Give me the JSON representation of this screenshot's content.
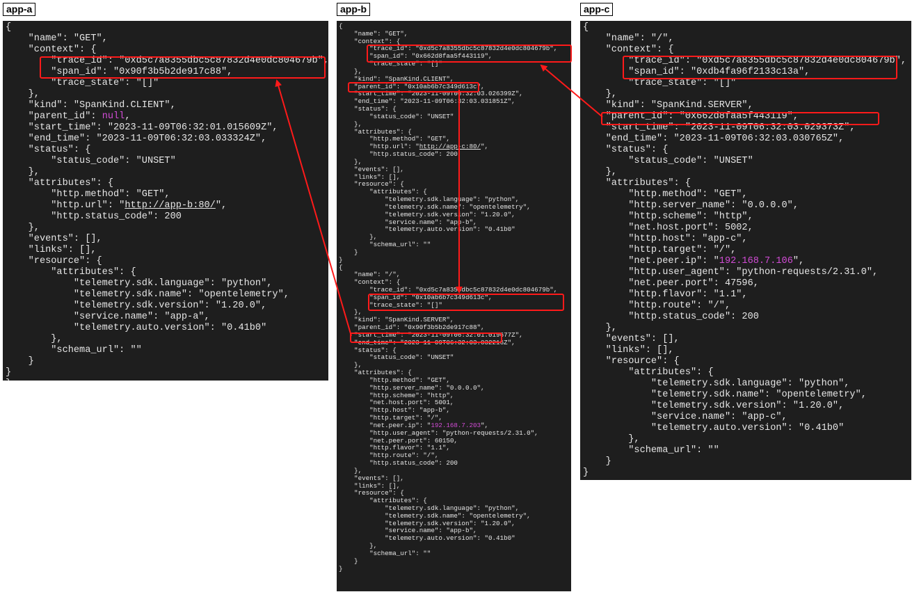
{
  "labels": {
    "a": "app-a",
    "b": "app-b",
    "c": "app-c"
  },
  "colors": {
    "terminal_bg": "#1e1e1e",
    "text": "#e6e6e6",
    "highlight_box": "#ff1a1a",
    "null_and_ip": "#d24cd6"
  },
  "app_a": {
    "top_fragment": "{",
    "lines": [
      "{",
      "    \"name\": \"GET\",",
      "    \"context\": {",
      "        \"trace_id\": \"0xd5c7a8355dbc5c87832d4e0dc804679b\",",
      "        \"span_id\": \"0x90f3b5b2de917c88\",",
      "        \"trace_state\": \"[]\"",
      "    },",
      "    \"kind\": \"SpanKind.CLIENT\",",
      "    \"parent_id\": null,",
      "    \"start_time\": \"2023-11-09T06:32:01.015609Z\",",
      "    \"end_time\": \"2023-11-09T06:32:03.033324Z\",",
      "    \"status\": {",
      "        \"status_code\": \"UNSET\"",
      "    },",
      "    \"attributes\": {",
      "        \"http.method\": \"GET\",",
      "        \"http.url\": \"http://app-b:80/\",",
      "        \"http.status_code\": 200",
      "    },",
      "    \"events\": [],",
      "    \"links\": [],",
      "    \"resource\": {",
      "        \"attributes\": {",
      "            \"telemetry.sdk.language\": \"python\",",
      "            \"telemetry.sdk.name\": \"opentelemetry\",",
      "            \"telemetry.sdk.version\": \"1.20.0\",",
      "            \"service.name\": \"app-a\",",
      "            \"telemetry.auto.version\": \"0.41b0\"",
      "        },",
      "        \"schema_url\": \"\"",
      "    }",
      "}",
      "}"
    ]
  },
  "app_b": {
    "lines": [
      "{",
      "    \"name\": \"GET\",",
      "    \"context\": {",
      "        \"trace_id\": \"0xd5c7a8355dbc5c87832d4e0dc804679b\",",
      "        \"span_id\": \"0x662d8faa5f443119\",",
      "        \"trace_state\": \"[]\"",
      "    },",
      "    \"kind\": \"SpanKind.CLIENT\",",
      "    \"parent_id\": \"0x10ab6b7c349d613c\",",
      "    \"start_time\": \"2023-11-09T06:32:03.026399Z\",",
      "    \"end_time\": \"2023-11-09T06:32:03.031851Z\",",
      "    \"status\": {",
      "        \"status_code\": \"UNSET\"",
      "    },",
      "    \"attributes\": {",
      "        \"http.method\": \"GET\",",
      "        \"http.url\": \"http://app-c:80/\",",
      "        \"http.status_code\": 200",
      "    },",
      "    \"events\": [],",
      "    \"links\": [],",
      "    \"resource\": {",
      "        \"attributes\": {",
      "            \"telemetry.sdk.language\": \"python\",",
      "            \"telemetry.sdk.name\": \"opentelemetry\",",
      "            \"telemetry.sdk.version\": \"1.20.0\",",
      "            \"service.name\": \"app-b\",",
      "            \"telemetry.auto.version\": \"0.41b0\"",
      "        },",
      "        \"schema_url\": \"\"",
      "    }",
      "}",
      "{",
      "    \"name\": \"/\",",
      "    \"context\": {",
      "        \"trace_id\": \"0xd5c7a8355dbc5c87832d4e0dc804679b\",",
      "        \"span_id\": \"0x10ab6b7c349d613c\",",
      "        \"trace_state\": \"[]\"",
      "    },",
      "    \"kind\": \"SpanKind.SERVER\",",
      "    \"parent_id\": \"0x90f3b5b2de917c88\",",
      "    \"start_time\": \"2023-11-09T06:32:01.019677Z\",",
      "    \"end_time\": \"2023-11-09T06:32:03.032216Z\",",
      "    \"status\": {",
      "        \"status_code\": \"UNSET\"",
      "    },",
      "    \"attributes\": {",
      "        \"http.method\": \"GET\",",
      "        \"http.server_name\": \"0.0.0.0\",",
      "        \"http.scheme\": \"http\",",
      "        \"net.host.port\": 5001,",
      "        \"http.host\": \"app-b\",",
      "        \"http.target\": \"/\",",
      "        \"net.peer.ip\": \"192.168.7.203\",",
      "        \"http.user_agent\": \"python-requests/2.31.0\",",
      "        \"net.peer.port\": 60150,",
      "        \"http.flavor\": \"1.1\",",
      "        \"http.route\": \"/\",",
      "        \"http.status_code\": 200",
      "    },",
      "    \"events\": [],",
      "    \"links\": [],",
      "    \"resource\": {",
      "        \"attributes\": {",
      "            \"telemetry.sdk.language\": \"python\",",
      "            \"telemetry.sdk.name\": \"opentelemetry\",",
      "            \"telemetry.sdk.version\": \"1.20.0\",",
      "            \"service.name\": \"app-b\",",
      "            \"telemetry.auto.version\": \"0.41b0\"",
      "        },",
      "        \"schema_url\": \"\"",
      "    }",
      "}"
    ]
  },
  "app_c": {
    "lines": [
      "{",
      "    \"name\": \"/\",",
      "    \"context\": {",
      "        \"trace_id\": \"0xd5c7a8355dbc5c87832d4e0dc804679b\",",
      "        \"span_id\": \"0xdb4fa96f2133c13a\",",
      "        \"trace_state\": \"[]\"",
      "    },",
      "    \"kind\": \"SpanKind.SERVER\",",
      "    \"parent_id\": \"0x662d8faa5f443119\",",
      "    \"start_time\": \"2023-11-09T06:32:03.029373Z\",",
      "    \"end_time\": \"2023-11-09T06:32:03.030765Z\",",
      "    \"status\": {",
      "        \"status_code\": \"UNSET\"",
      "    },",
      "    \"attributes\": {",
      "        \"http.method\": \"GET\",",
      "        \"http.server_name\": \"0.0.0.0\",",
      "        \"http.scheme\": \"http\",",
      "        \"net.host.port\": 5002,",
      "        \"http.host\": \"app-c\",",
      "        \"http.target\": \"/\",",
      "        \"net.peer.ip\": \"192.168.7.106\",",
      "        \"http.user_agent\": \"python-requests/2.31.0\",",
      "        \"net.peer.port\": 47596,",
      "        \"http.flavor\": \"1.1\",",
      "        \"http.route\": \"/\",",
      "        \"http.status_code\": 200",
      "    },",
      "    \"events\": [],",
      "    \"links\": [],",
      "    \"resource\": {",
      "        \"attributes\": {",
      "            \"telemetry.sdk.language\": \"python\",",
      "            \"telemetry.sdk.name\": \"opentelemetry\",",
      "            \"telemetry.sdk.version\": \"1.20.0\",",
      "            \"service.name\": \"app-c\",",
      "            \"telemetry.auto.version\": \"0.41b0\"",
      "        },",
      "        \"schema_url\": \"\"",
      "    }",
      "}"
    ]
  }
}
